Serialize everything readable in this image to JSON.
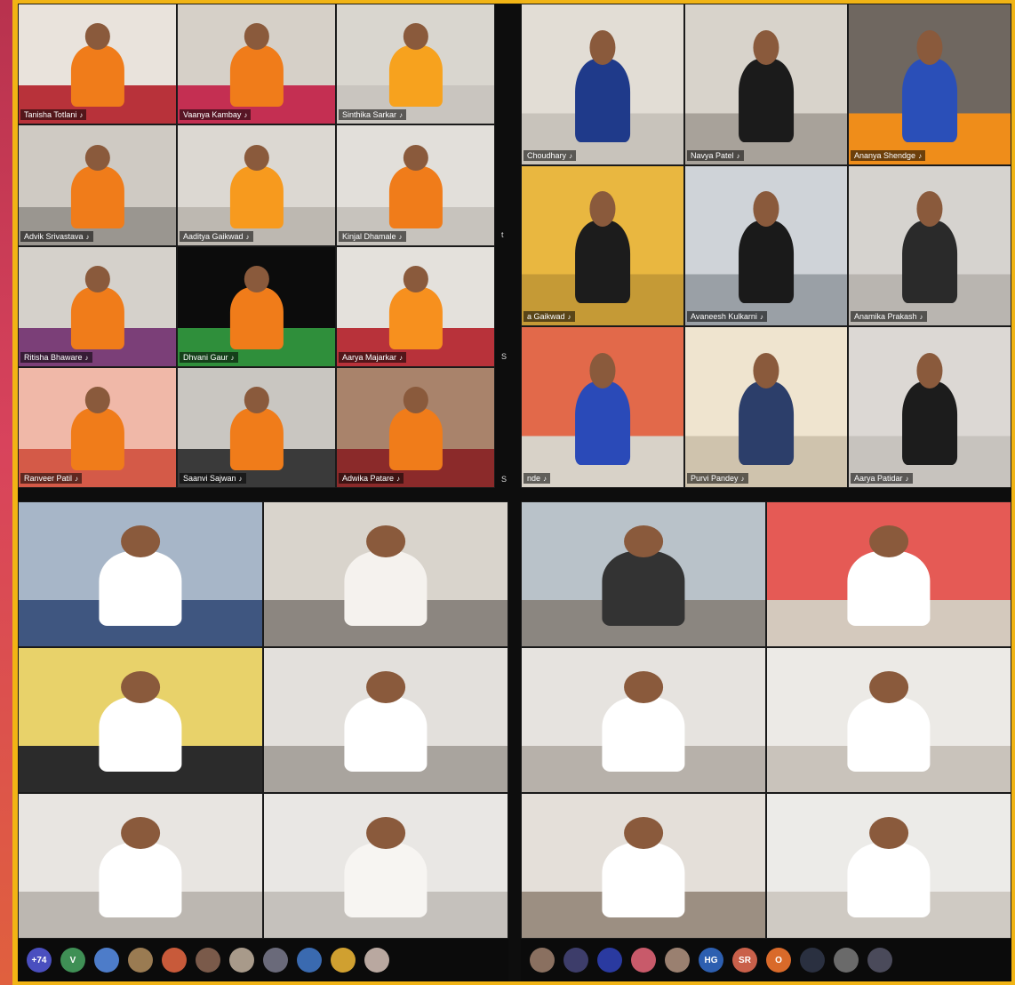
{
  "panels": {
    "top_left": {
      "tiles": [
        {
          "name": "Tanisha Totlani",
          "bg": "#e9e3dc",
          "shirt": "#f07c1a",
          "floor": "#b8323a"
        },
        {
          "name": "Vaanya Kambay",
          "bg": "#d6d0c8",
          "shirt": "#f07c1a",
          "floor": "#c42f52"
        },
        {
          "name": "Sinthika Sarkar",
          "bg": "#d9d6cf",
          "shirt": "#f7a21e",
          "floor": "#c9c5bf"
        },
        {
          "name": "Advik Srivastava",
          "bg": "#cfcac3",
          "shirt": "#f07c1a",
          "floor": "#9a9690"
        },
        {
          "name": "Aaditya Gaikwad",
          "bg": "#dcd8d2",
          "shirt": "#f79a1e",
          "floor": "#bdb8b1"
        },
        {
          "name": "Kinjal Dhamale",
          "bg": "#e2dfda",
          "shirt": "#f07c1a",
          "floor": "#c7c3bd"
        },
        {
          "name": "Ritisha Bhaware",
          "bg": "#d5d1cb",
          "shirt": "#f07c1a",
          "floor": "#7b3f78"
        },
        {
          "name": "Dhvani Gaur",
          "bg": "#0c0c0c",
          "shirt": "#f07c1a",
          "floor": "#2f8f3b"
        },
        {
          "name": "Aarya Majarkar",
          "bg": "#e4e1dc",
          "shirt": "#f7901e",
          "floor": "#b8323a"
        },
        {
          "name": "Ranveer Patil",
          "bg": "#f0b8a8",
          "shirt": "#f07c1a",
          "floor": "#d45a48"
        },
        {
          "name": "Saanvi Sajwan",
          "bg": "#c9c6c1",
          "shirt": "#f07c1a",
          "floor": "#3a3a3a"
        },
        {
          "name": "Adwika Patare",
          "bg": "#a9836b",
          "shirt": "#f07c1a",
          "floor": "#8b2a2a"
        }
      ]
    },
    "top_right": {
      "tiles": [
        {
          "name": "Choudhary",
          "bg": "#e2ddd5",
          "shirt": "#1f3a8a",
          "floor": "#c8c3bb"
        },
        {
          "name": "Navya Patel",
          "bg": "#d8d3cb",
          "shirt": "#1b1b1b",
          "floor": "#a8a29a"
        },
        {
          "name": "Ananya Shendge",
          "bg": "#6f6760",
          "shirt": "#2a4fb8",
          "floor": "#ef8d1a"
        },
        {
          "name": "a Gaikwad",
          "bg": "#e9b740",
          "shirt": "#1c1c1c",
          "floor": "#c59a36"
        },
        {
          "name": "Avaneesh Kulkarni",
          "bg": "#cfd3d8",
          "shirt": "#1a1a1a",
          "floor": "#9aa0a6"
        },
        {
          "name": "Anamika Prakash",
          "bg": "#d6d3cf",
          "shirt": "#2a2a2a",
          "floor": "#b9b5b0"
        },
        {
          "name": "nde",
          "bg": "#e2694a",
          "shirt": "#2a4ab8",
          "floor": "#d8d2c8"
        },
        {
          "name": "Purvi Pandey",
          "bg": "#efe4cf",
          "shirt": "#2c3e6a",
          "floor": "#cfc3ad"
        },
        {
          "name": "Aarya Patidar",
          "bg": "#dcd8d4",
          "shirt": "#1c1c1c",
          "floor": "#c7c3be"
        }
      ]
    },
    "bottom_left": {
      "tiles": [
        {
          "bg": "#a7b6c8",
          "shirt": "#ffffff",
          "floor": "#3f5680"
        },
        {
          "bg": "#d9d4cc",
          "shirt": "#f5f2ee",
          "floor": "#8c8680"
        },
        {
          "bg": "#e8d26a",
          "shirt": "#ffffff",
          "floor": "#2b2b2b"
        },
        {
          "bg": "#e3e0dc",
          "shirt": "#ffffff",
          "floor": "#a9a49e"
        },
        {
          "bg": "#e8e5e1",
          "shirt": "#ffffff",
          "floor": "#bcb7b1"
        },
        {
          "bg": "#e9e7e4",
          "shirt": "#f7f5f2",
          "floor": "#c5c1bc"
        }
      ]
    },
    "bottom_right": {
      "tiles": [
        {
          "bg": "#b9c2c9",
          "shirt": "#333333",
          "floor": "#8b8680"
        },
        {
          "bg": "#e55a55",
          "shirt": "#ffffff",
          "floor": "#d4c9bd"
        },
        {
          "bg": "#e6e3df",
          "shirt": "#ffffff",
          "floor": "#b7b1aa"
        },
        {
          "bg": "#eceae6",
          "shirt": "#ffffff",
          "floor": "#c9c3bb"
        },
        {
          "bg": "#e4dfd9",
          "shirt": "#ffffff",
          "floor": "#9c8f82"
        },
        {
          "bg": "#ecebe8",
          "shirt": "#ffffff",
          "floor": "#cfcac3"
        }
      ]
    }
  },
  "participant_bar_left": [
    {
      "label": "+74",
      "color": "#4a4fbf"
    },
    {
      "label": "V",
      "color": "#3f8f55"
    },
    {
      "label": "",
      "color": "#4d7cc9"
    },
    {
      "label": "",
      "color": "#9a7b52"
    },
    {
      "label": "",
      "color": "#c85a3a"
    },
    {
      "label": "",
      "color": "#7a5a4a"
    },
    {
      "label": "",
      "color": "#a89a8a"
    },
    {
      "label": "",
      "color": "#6a6a7a"
    },
    {
      "label": "",
      "color": "#3a6ab0"
    },
    {
      "label": "",
      "color": "#d0a030"
    },
    {
      "label": "",
      "color": "#b9a8a0"
    }
  ],
  "participant_bar_right": [
    {
      "label": "",
      "color": "#8a7060"
    },
    {
      "label": "",
      "color": "#3d3d6a"
    },
    {
      "label": "",
      "color": "#2a3aa0"
    },
    {
      "label": "",
      "color": "#c85a6a"
    },
    {
      "label": "",
      "color": "#9a8070"
    },
    {
      "label": "HG",
      "color": "#2d5fb0"
    },
    {
      "label": "SR",
      "color": "#c9604a"
    },
    {
      "label": "O",
      "color": "#d96a2a"
    },
    {
      "label": "",
      "color": "#2a3040"
    },
    {
      "label": "",
      "color": "#6a6a6a"
    },
    {
      "label": "",
      "color": "#4a4a5a"
    }
  ]
}
